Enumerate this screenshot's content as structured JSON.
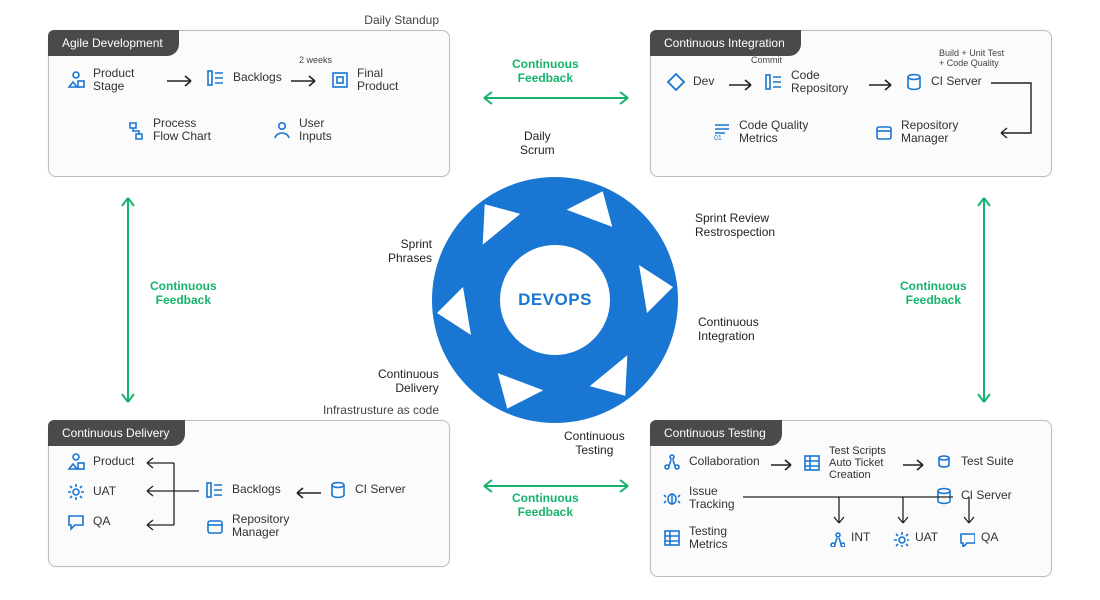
{
  "panels": {
    "agile": {
      "title": "Agile Development",
      "subtitle": "Daily Standup",
      "items": {
        "product_stage": "Product\nStage",
        "backlogs": "Backlogs",
        "backlogs_duration": "2 weeks",
        "final_product": "Final\nProduct",
        "process_flow": "Process\nFlow Chart",
        "user_inputs": "User\nInputs"
      }
    },
    "ci": {
      "title": "Continuous Integration",
      "row_labels": {
        "commit": "Commit",
        "build": "Build + Unit Test\n+ Code Quality"
      },
      "items": {
        "dev": "Dev",
        "code_repo": "Code\nRepository",
        "ci_server": "CI Server",
        "code_quality": "Code Quality\nMetrics",
        "repo_manager": "Repository\nManager"
      }
    },
    "cd": {
      "title": "Continuous Delivery",
      "subtitle": "Infrastrusture as code",
      "items": {
        "product": "Product",
        "uat": "UAT",
        "qa": "QA",
        "backlogs": "Backlogs",
        "ci_server": "CI Server",
        "repo_manager": "Repository\nManager"
      }
    },
    "ct": {
      "title": "Continuous Testing",
      "items": {
        "collab": "Collaboration",
        "tickets": "Test Scripts\nAuto Ticket\nCreation",
        "test_suite": "Test Suite",
        "issue": "Issue\nTracking",
        "ci_server": "CI Server",
        "metrics": "Testing\nMetrics",
        "int": "INT",
        "uat": "UAT",
        "qa": "QA"
      }
    }
  },
  "cycle": {
    "center": "DEVOPS",
    "labels": {
      "daily_scrum": "Daily\nScrum",
      "sprint_review": "Sprint Review\nRestrospection",
      "cont_integration": "Continuous\nIntegration",
      "cont_testing": "Continuous\nTesting",
      "cont_delivery": "Continuous\nDelivery",
      "sprint_phrases": "Sprint\nPhrases"
    }
  },
  "feedback": {
    "label": "Continuous\nFeedback"
  }
}
